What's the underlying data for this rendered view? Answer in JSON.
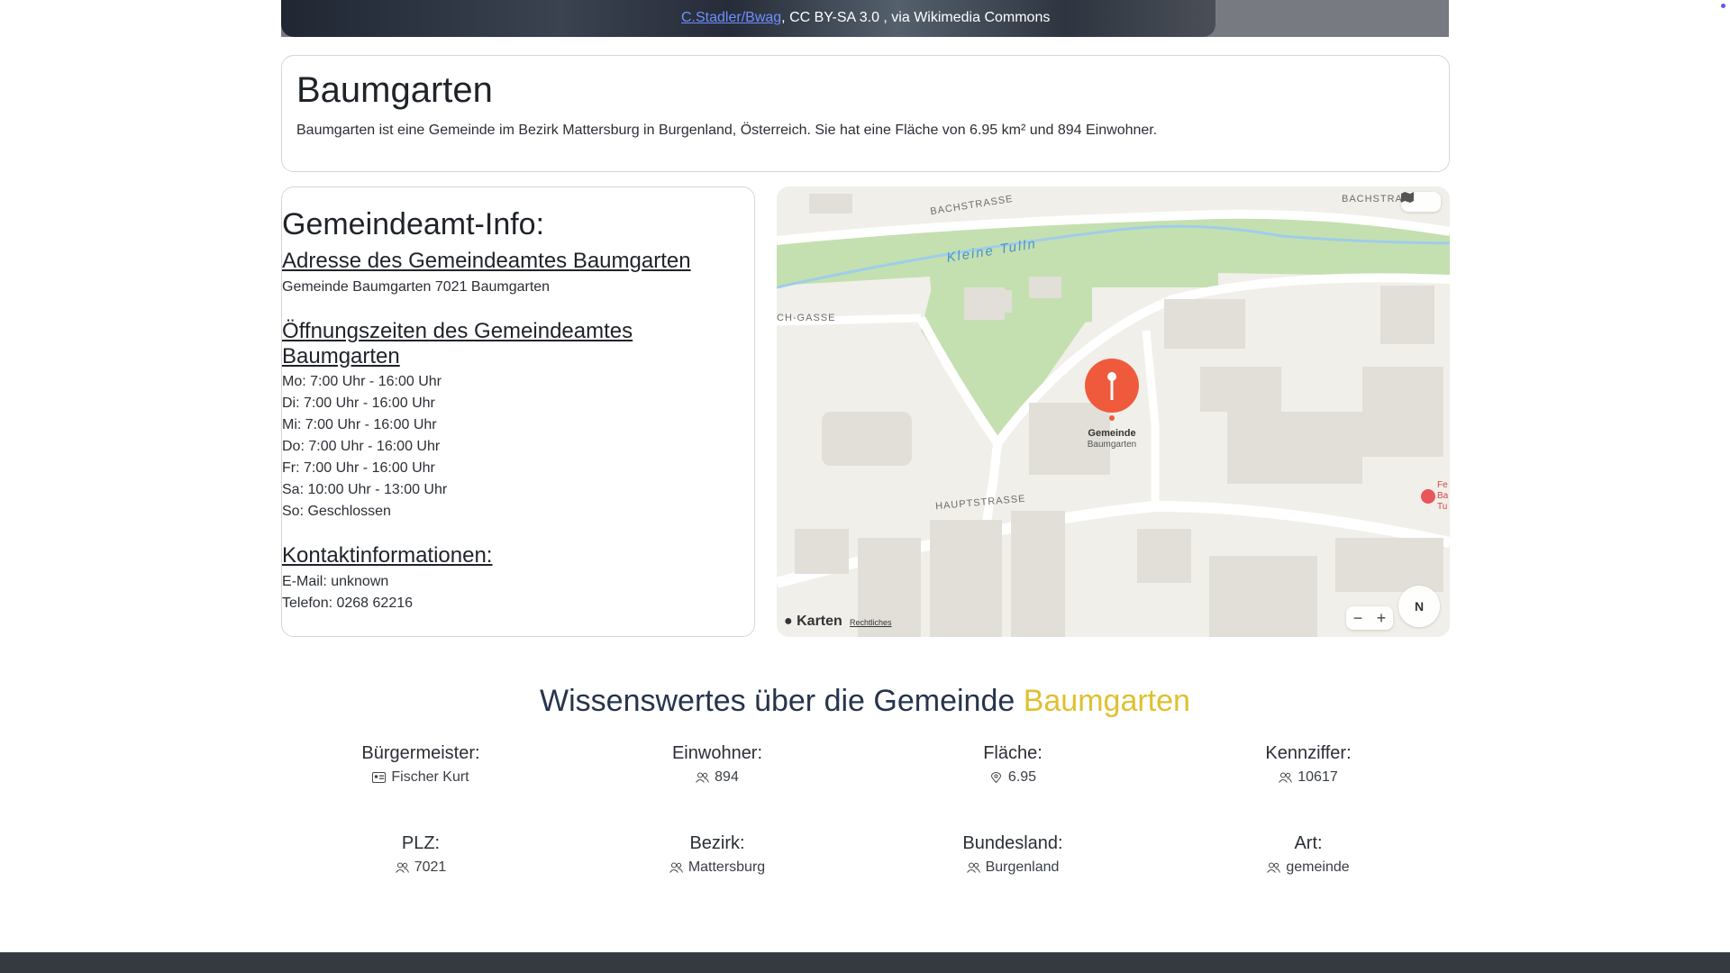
{
  "hero": {
    "credit_link": "C.Stadler/Bwag",
    "credit_rest": ", CC BY-SA 3.0 , via Wikimedia Commons"
  },
  "title_card": {
    "title": "Baumgarten",
    "description": "Baumgarten ist eine Gemeinde im Bezirk Mattersburg in Burgenland, Österreich. Sie hat eine Fläche von 6.95 km² und 894 Einwohner."
  },
  "info": {
    "heading": "Gemeindeamt-Info:",
    "address_title": "Adresse des Gemeindeamtes Baumgarten",
    "address": "Gemeinde Baumgarten 7021 Baumgarten",
    "hours_title_1": "Öffnungszeiten des Gemeindeamtes",
    "hours_title_2": "Baumgarten",
    "hours": [
      "Mo: 7:00 Uhr - 16:00 Uhr",
      "Di: 7:00 Uhr - 16:00 Uhr",
      "Mi: 7:00 Uhr - 16:00 Uhr",
      "Do: 7:00 Uhr - 16:00 Uhr",
      "Fr: 7:00 Uhr - 16:00 Uhr",
      "Sa: 10:00 Uhr - 13:00 Uhr",
      "So: Geschlossen"
    ],
    "contact_title": "Kontaktinformationen:",
    "email": "E-Mail: unknown",
    "phone": "Telefon: 0268 62216"
  },
  "map": {
    "streets": [
      "BACHSTRASSE",
      "BACHSTRA",
      "CH-GASSE",
      "HAUPTSTRASSE"
    ],
    "river": "Kleine Tulln",
    "pin_title": "Gemeinde",
    "pin_subtitle": "Baumgarten",
    "poi_text": "Fe Ba Tu",
    "brand": "Karten",
    "legal": "Rechtliches",
    "compass": "N",
    "zoom_out": "−",
    "zoom_in": "+"
  },
  "facts": {
    "title_prefix": "Wissenswertes über die Gemeinde",
    "title_name": "Baumgarten",
    "items": [
      {
        "label": "Bürgermeister:",
        "value": "Fischer Kurt",
        "icon": "id-card-icon"
      },
      {
        "label": "Einwohner:",
        "value": "894",
        "icon": "people-icon"
      },
      {
        "label": "Fläche:",
        "value": "6.95",
        "icon": "location-pin-icon"
      },
      {
        "label": "Kennziffer:",
        "value": "10617",
        "icon": "people-icon"
      },
      {
        "label": "PLZ:",
        "value": "7021",
        "icon": "people-icon"
      },
      {
        "label": "Bezirk:",
        "value": "Mattersburg",
        "icon": "people-icon"
      },
      {
        "label": "Bundesland:",
        "value": "Burgenland",
        "icon": "people-icon"
      },
      {
        "label": "Art:",
        "value": "gemeinde",
        "icon": "people-icon"
      }
    ]
  },
  "colors": {
    "accent": "#e0c030",
    "heading": "#26344c",
    "pin": "#ef5a3c",
    "footer": "#343a40"
  }
}
